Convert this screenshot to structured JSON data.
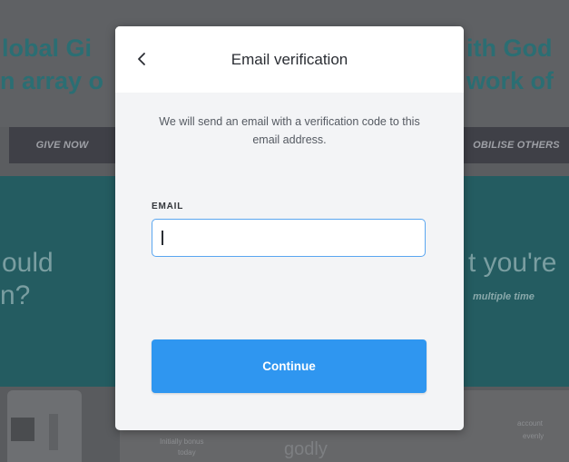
{
  "background": {
    "headline_left_1": "lobal Gi",
    "headline_left_2": "n array o",
    "headline_right_1": "ith God",
    "headline_right_2": "work of",
    "give_now_label": "GIVE NOW",
    "mobilise_label": "OBILISE OTHERS",
    "question_left_1": "ould",
    "question_left_2": "n?",
    "question_right": "t you're",
    "italic_right": "multiple time",
    "small_left": "Initially bonus",
    "small_left_2": "today",
    "godly_text": "godly",
    "small_right": "account",
    "small_right_2": "evenly"
  },
  "modal": {
    "title": "Email verification",
    "back_icon": "chevron-left-icon",
    "description": "We will send an email with a verification code to this email address.",
    "email_label": "EMAIL",
    "email_value": "",
    "email_placeholder": "",
    "continue_label": "Continue",
    "accent_color": "#2f96f0",
    "focus_border_color": "#5aa6f0"
  }
}
